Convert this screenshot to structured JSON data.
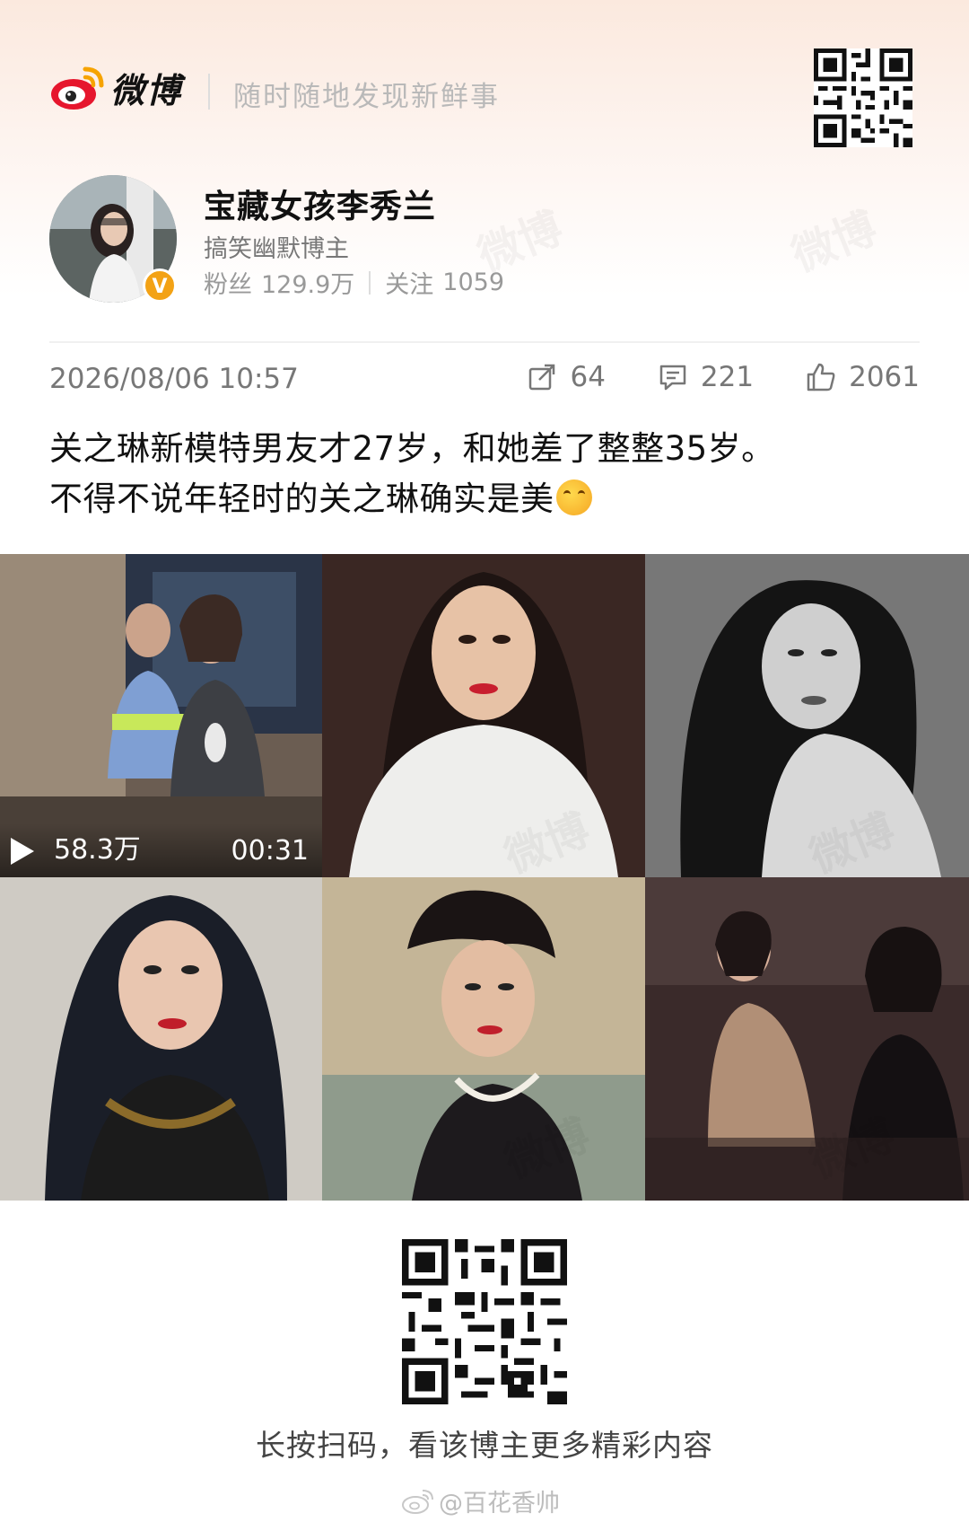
{
  "brand": {
    "logo_text": "微博",
    "slogan": "随时随地发现新鲜事"
  },
  "profile": {
    "username": "宝藏女孩李秀兰",
    "description": "搞笑幽默博主",
    "fans_label": "粉丝",
    "fans_value": "129.9万",
    "follow_label": "关注",
    "follow_value": "1059",
    "verify_badge": "V"
  },
  "post": {
    "date": "2026/08/06 10:57",
    "reposts": "64",
    "comments": "221",
    "likes": "2061",
    "text_line1": "关之琳新模特男友才27岁，和她差了整整35岁。",
    "text_line2": "不得不说年轻时的关之琳确实是美"
  },
  "video": {
    "views": "58.3万",
    "duration": "00:31"
  },
  "footer": {
    "scan_hint": "长按扫码，看该博主更多精彩内容",
    "source": "@百花香帅"
  },
  "watermark": "微博",
  "icons": {
    "repost": "repost-icon",
    "comment": "comment-icon",
    "like": "thumbs-up-icon",
    "play": "play-icon"
  },
  "colors": {
    "accent": "#e6162d",
    "verify": "#f3a215",
    "muted": "#999999"
  }
}
